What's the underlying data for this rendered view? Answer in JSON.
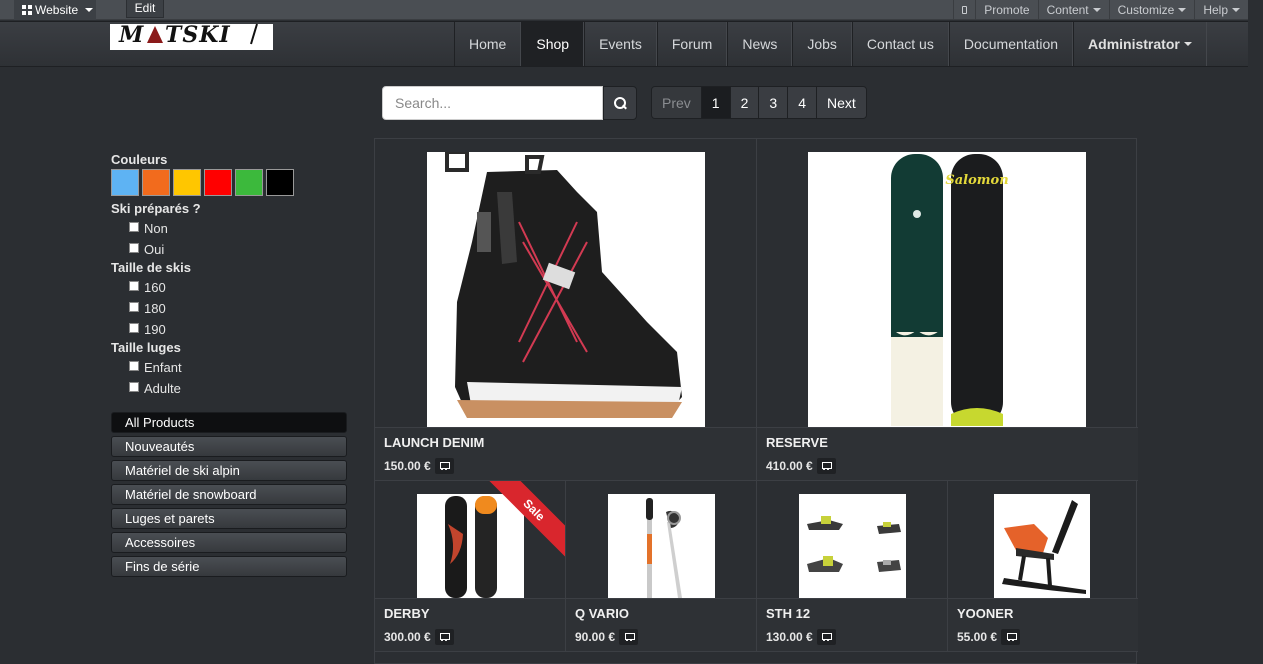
{
  "admin_bar": {
    "website_label": "Website",
    "edit_label": "Edit",
    "right_items": [
      {
        "label": "",
        "icon": "mobile-icon"
      },
      {
        "label": "Promote",
        "icon": ""
      },
      {
        "label": "Content",
        "icon": "caret"
      },
      {
        "label": "Customize",
        "icon": "caret"
      },
      {
        "label": "Help",
        "icon": "caret"
      }
    ]
  },
  "brand": {
    "logo_text": "MATSKI"
  },
  "nav": {
    "items": [
      "Home",
      "Shop",
      "Events",
      "Forum",
      "News",
      "Jobs",
      "Contact us",
      "Documentation"
    ],
    "active": "Shop",
    "admin_label": "Administrator"
  },
  "search": {
    "placeholder": "Search...",
    "value": ""
  },
  "pager": {
    "prev": "Prev",
    "pages": [
      "1",
      "2",
      "3",
      "4"
    ],
    "current": "1",
    "next": "Next"
  },
  "filters": {
    "colors_title": "Couleurs",
    "colors": [
      "#5eb3f3",
      "#f26b1d",
      "#ffc600",
      "#ff0000",
      "#3cb93c",
      "#000000"
    ],
    "groups": [
      {
        "title": "Ski préparés ?",
        "options": [
          "Non",
          "Oui"
        ]
      },
      {
        "title": "Taille de skis",
        "options": [
          "160",
          "180",
          "190"
        ]
      },
      {
        "title": "Taille luges",
        "options": [
          "Enfant",
          "Adulte"
        ]
      }
    ]
  },
  "categories": {
    "items": [
      "All Products",
      "Nouveautés",
      "Matériel de ski alpin",
      "Matériel de snowboard",
      "Luges et parets",
      "Accessoires",
      "Fins de série"
    ],
    "active": "All Products"
  },
  "products": [
    {
      "name": "LAUNCH DENIM",
      "price": "150.00 €",
      "image": "snowboard-boot"
    },
    {
      "name": "RESERVE",
      "price": "410.00 €",
      "image": "snowboard-pair"
    },
    {
      "name": "DERBY",
      "price": "300.00 €",
      "image": "snowboard",
      "badge": "Sale"
    },
    {
      "name": "Q VARIO",
      "price": "90.00 €",
      "image": "ski-poles"
    },
    {
      "name": "STH 12",
      "price": "130.00 €",
      "image": "ski-bindings"
    },
    {
      "name": "YOONER",
      "price": "55.00 €",
      "image": "ski-bike"
    }
  ]
}
